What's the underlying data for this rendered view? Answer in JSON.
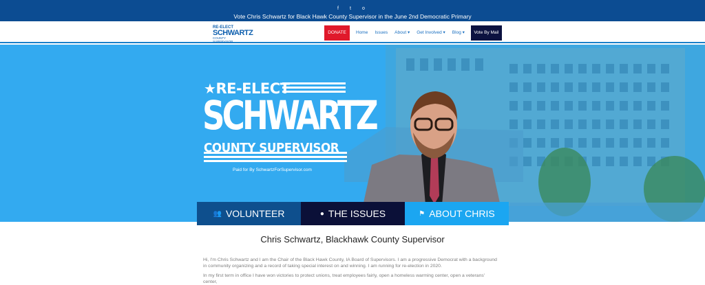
{
  "topbar": {
    "social_icons": [
      "facebook-icon",
      "twitter-icon",
      "instagram-icon"
    ],
    "social_glyphs": [
      "f",
      "t",
      "o"
    ],
    "announcement": "Vote Chris Schwartz for Black Hawk County Supervisor in the June 2nd Democratic Primary"
  },
  "logo": {
    "line1": "RE-ELECT",
    "line2": "SCHWARTZ",
    "line3": "COUNTY SUPERVISOR"
  },
  "nav": {
    "donate": "DONATE",
    "home": "Home",
    "issues": "Issues",
    "about": "About",
    "get_involved": "Get Involved",
    "blog": "Blog",
    "vote_by_mail": "Vote By Mail",
    "caret": "▾"
  },
  "hero": {
    "star": "★",
    "reelect": "RE-ELECT",
    "name": "SCHWARTZ",
    "office": "COUNTY SUPERVISOR",
    "paid_for": "Paid for By SchwartzForSupervisor.com"
  },
  "cta": {
    "volunteer": "VOLUNTEER",
    "issues": "THE ISSUES",
    "about": "ABOUT CHRIS",
    "volunteer_icon": "👥",
    "issues_icon": "●",
    "about_icon": "⚑"
  },
  "content": {
    "title": "Chris Schwartz, Blackhawk County Supervisor",
    "para1": "Hi, I'm Chris Schwartz and I am the Chair of the Black Hawk County, IA Board of Supervisors. I am a progressive Democrat with a background in community organizing and a record of taking special interest on and winning. I am running for re-election in 2020.",
    "para2": "In my first term in office I have won victories to protect unions, treat employees fairly, open a homeless warming center, open a veterans' center,"
  },
  "colors": {
    "topbar": "#0c4c92",
    "hero": "#33aaf0",
    "donate": "#e0192b",
    "vote_by_mail": "#0c1240",
    "cta_volunteer": "#0e4f8d",
    "cta_issues": "#0b1038",
    "cta_about": "#1ba6f1"
  }
}
